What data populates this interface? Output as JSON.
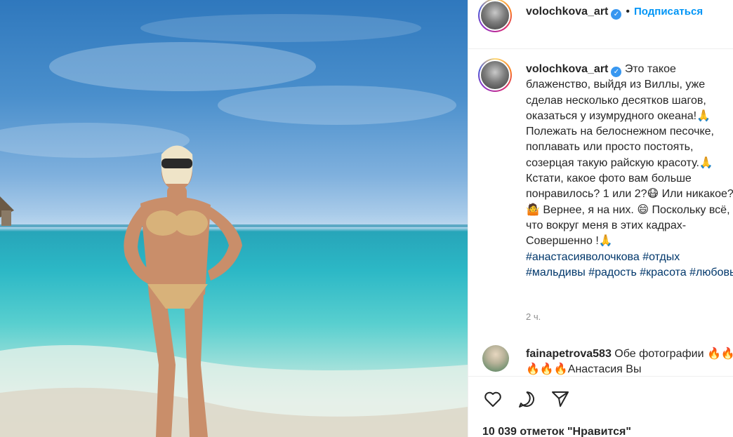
{
  "post": {
    "username": "volochkova_art",
    "follow_label": "Подписаться",
    "dot": "•",
    "caption_text": "Это такое блаженство, выйдя из Виллы, уже сделав несколько десятков шагов, оказаться у изумрудного океана!🙏 Полежать на белоснежном песочке, поплавать или просто постоять, созерцая такую райскую красоту.🙏 Кстати, какое фото вам больше понравилось? 1 или 2?😷 Или никакое?🤷 Вернее, я на них. 😄 Поскольку всё, что вокруг меня в этих кадрах-Совершенно !🙏",
    "hashtags": "#анастасияволочкова #отдых #мальдивы #радость #красота #любовь",
    "time": "2 ч.",
    "likes": "10 039 отметок \"Нравится\""
  },
  "comment": {
    "username": "fainapetrova583",
    "text": "Обе фотографии 🔥🔥🔥🔥🔥Анастасия Вы"
  },
  "icons": {
    "verified": "verified-badge-icon",
    "like": "heart-icon",
    "comment": "comment-icon",
    "share": "share-icon"
  },
  "colors": {
    "accent": "#0095f6",
    "verified": "#3897f0",
    "hashtag": "#00376b",
    "muted": "#8e8e8e"
  }
}
